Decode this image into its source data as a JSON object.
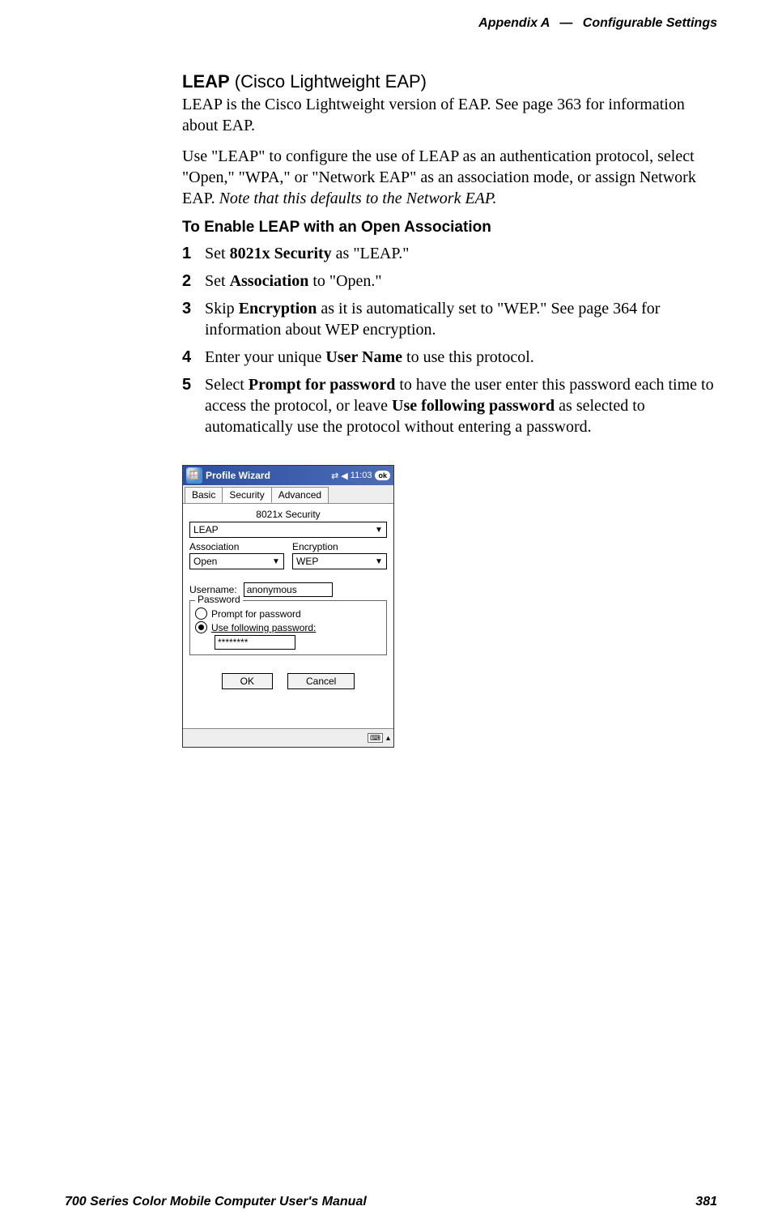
{
  "header": {
    "appendix": "Appendix A",
    "dash": "—",
    "title": "Configurable Settings"
  },
  "section": {
    "title_bold": "LEAP",
    "title_rest": " (Cisco Lightweight EAP)",
    "para1": "LEAP is the Cisco Lightweight version of EAP. See page 363 for information about EAP.",
    "para2_a": "Use \"LEAP\" to configure the use of LEAP as an authentication protocol, select \"Open,\" \"WPA,\" or \"Network EAP\" as an association mode, or assign Network EAP. ",
    "para2_italic": "Note that this defaults to the Network EAP."
  },
  "subheading": "To Enable LEAP with an Open Association",
  "steps": {
    "s1": {
      "num": "1",
      "a": "Set ",
      "b": "8021x Security",
      "c": " as \"LEAP.\""
    },
    "s2": {
      "num": "2",
      "a": "Set ",
      "b": "Association",
      "c": " to \"Open.\""
    },
    "s3": {
      "num": "3",
      "a": "Skip ",
      "b": "Encryption",
      "c": " as it is automatically set to \"WEP.\" See page 364 for information about WEP encryption."
    },
    "s4": {
      "num": "4",
      "a": "Enter your unique ",
      "b": "User Name",
      "c": " to use this protocol."
    },
    "s5": {
      "num": "5",
      "a": "Select ",
      "b": "Prompt for password",
      "c": " to have the user enter this password each time to access the protocol, or leave ",
      "d": "Use following password",
      "e": " as selected to automatically use the protocol without entering a password."
    }
  },
  "screenshot": {
    "title": "Profile Wizard",
    "time": "11:03",
    "ok_text": "ok",
    "tabs": {
      "basic": "Basic",
      "security": "Security",
      "advanced": "Advanced"
    },
    "labels": {
      "security_header": "8021x Security",
      "association": "Association",
      "encryption": "Encryption",
      "username": "Username:",
      "password_legend": "Password",
      "prompt": "Prompt for password",
      "use_following": "Use following password:"
    },
    "values": {
      "security": "LEAP",
      "association": "Open",
      "encryption": "WEP",
      "username": "anonymous",
      "password_masked": "********"
    },
    "buttons": {
      "ok": "OK",
      "cancel": "Cancel"
    }
  },
  "footer": {
    "manual_title": "700 Series Color Mobile Computer User's Manual",
    "page_number": "381"
  }
}
